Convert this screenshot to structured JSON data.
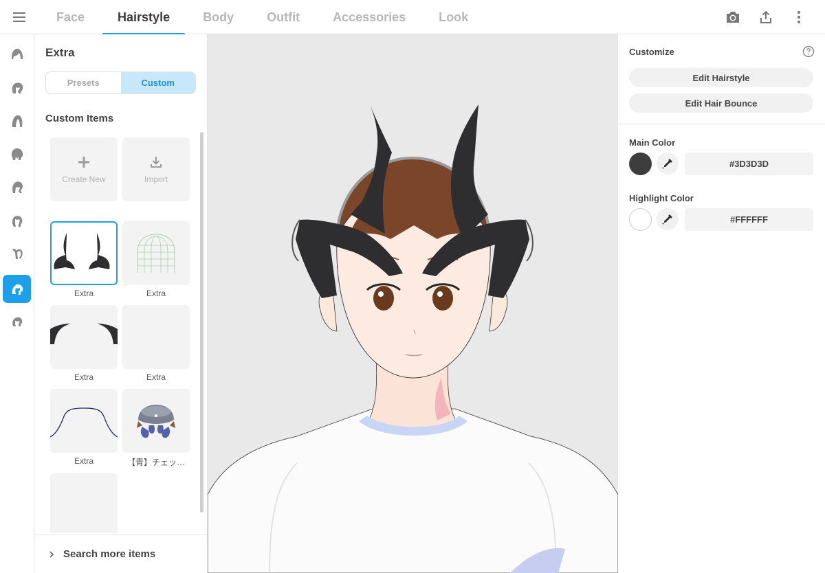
{
  "topbar": {
    "tabs": [
      {
        "label": "Face"
      },
      {
        "label": "Hairstyle"
      },
      {
        "label": "Body"
      },
      {
        "label": "Outfit"
      },
      {
        "label": "Accessories"
      },
      {
        "label": "Look"
      }
    ],
    "active_tab": "Hairstyle",
    "actions": [
      "camera-icon",
      "share-upload-icon",
      "more-vertical-icon"
    ]
  },
  "rail": {
    "active_index": 7,
    "items": [
      "hair-front-icon",
      "hair-back-icon",
      "hair-side-icon",
      "hair-full-icon",
      "hair-ponytail-icon",
      "hair-bangs-icon",
      "hair-ahoge-icon",
      "hair-extra-icon",
      "hair-base-icon"
    ]
  },
  "panel": {
    "title": "Extra",
    "segments": [
      {
        "label": "Presets"
      },
      {
        "label": "Custom"
      }
    ],
    "active_segment": "Custom",
    "section_title": "Custom Items",
    "actions": [
      {
        "label": "Create New",
        "icon": "plus-icon"
      },
      {
        "label": "Import",
        "icon": "download-icon"
      }
    ],
    "items": [
      {
        "caption": "Extra",
        "thumb": "horns"
      },
      {
        "caption": "Extra",
        "thumb": "wireframe"
      },
      {
        "caption": "Extra",
        "thumb": "arcs"
      },
      {
        "caption": "Extra",
        "thumb": "empty"
      },
      {
        "caption": "Extra",
        "thumb": "curve"
      },
      {
        "caption": "【青】チェッ…",
        "thumb": "hat"
      },
      {
        "caption": "",
        "thumb": "empty"
      }
    ],
    "search_more": "Search more items"
  },
  "right": {
    "title": "Customize",
    "buttons": [
      {
        "label": "Edit Hairstyle"
      },
      {
        "label": "Edit Hair Bounce"
      }
    ],
    "main_color": {
      "label": "Main Color",
      "value": "#3D3D3D"
    },
    "highlight_color": {
      "label": "Highlight Color",
      "value": "#FFFFFF"
    }
  },
  "colors": {
    "accent": "#1ea0e8",
    "accent_light": "#c7e8fb",
    "viewport_bg": "#e9e9e9",
    "horn": "#2e2e30",
    "hair": "#7a4528",
    "skin": "#fde8dc"
  }
}
